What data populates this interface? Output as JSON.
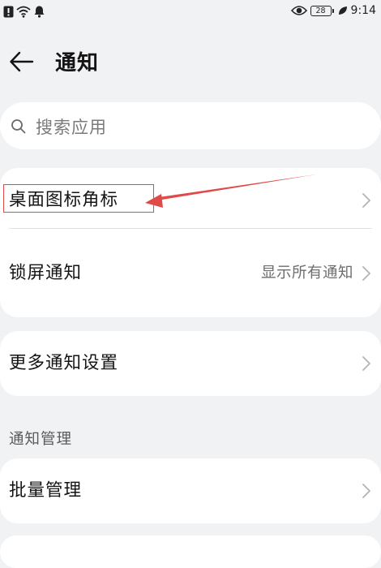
{
  "status_bar": {
    "time": "9:14",
    "battery_level": "28",
    "icons": [
      "alert-icon",
      "wifi-icon",
      "notification-bell-icon",
      "eye-icon",
      "battery-icon",
      "leaf-icon"
    ]
  },
  "header": {
    "title": "通知",
    "back_icon": "back-arrow-icon"
  },
  "search": {
    "placeholder": "搜索应用",
    "icon": "search-icon"
  },
  "settings": {
    "rows": [
      {
        "label": "桌面图标角标",
        "value": "",
        "highlighted": true
      },
      {
        "label": "锁屏通知",
        "value": "显示所有通知"
      },
      {
        "label": "更多通知设置",
        "value": ""
      }
    ]
  },
  "management": {
    "section_title": "通知管理",
    "rows": [
      {
        "label": "批量管理",
        "value": ""
      }
    ]
  },
  "colors": {
    "page_bg": "#f1f2f4",
    "card_bg": "#ffffff",
    "annotation_red": "#e04a48",
    "secondary_text": "#6e6e6e"
  }
}
